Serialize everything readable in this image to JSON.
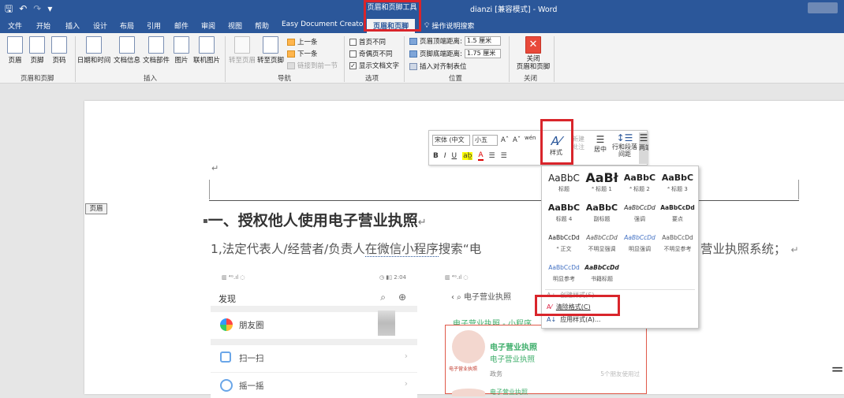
{
  "titlebar": {
    "quick_access": [
      "🖫",
      "↶",
      "↷",
      "▾"
    ],
    "contextual_tools": "页眉和页脚工具",
    "doc_title": "dianzi [兼容模式] - Word"
  },
  "tabs": [
    "文件",
    "开始",
    "插入",
    "设计",
    "布局",
    "引用",
    "邮件",
    "审阅",
    "视图",
    "帮助",
    "Easy Document Creato",
    "页眉和页脚",
    "操作说明搜索"
  ],
  "ribbon": {
    "header_footer": {
      "buttons": [
        "页眉",
        "页脚",
        "页码"
      ],
      "label": "页眉和页脚"
    },
    "insert": {
      "buttons": [
        "日期和时间",
        "文档信息",
        "文档部件",
        "图片",
        "联机图片"
      ],
      "label": "插入"
    },
    "navigation": {
      "buttons": [
        "转至页眉",
        "转至页脚"
      ],
      "prev": "上一条",
      "next": "下一条",
      "link": "链接到前一节",
      "label": "导航"
    },
    "options": {
      "first_page": "首页不同",
      "odd_even": "奇偶页不同",
      "show_text": "显示文档文字",
      "label": "选项"
    },
    "position": {
      "top_label": "页眉顶端距离:",
      "top_value": "1.5 厘米",
      "bottom_label": "页脚底端距离:",
      "bottom_value": "1.75 厘米",
      "align_tab": "插入对齐制表位",
      "label": "位置"
    },
    "close": {
      "button": "关闭\n页眉和页脚",
      "label": "关闭"
    }
  },
  "document": {
    "header_tag": "页眉",
    "pilcrow": "↵",
    "heading": "一、授权他人使用电子营业执照",
    "body_start": "1,法定代表人/经营者/负责人",
    "body_link": "在微信小程序",
    "body_mid": "搜索“电",
    "body_tail": "营业执照系统；",
    "phone1": {
      "status_left": "▥ ⁴ᴳ.ıl ◌",
      "status_right": "◷ ▮▯ 2:04",
      "title": "发现",
      "rows": [
        "朋友圈",
        "扫一扫",
        "摇一摇"
      ]
    },
    "phone2": {
      "status": "▥ ⁴ᴳ.ıl ◌",
      "nav": "‹  ⌕ 电子营业执照",
      "miniapp": "电子营业执照 - 小程序",
      "card_title": "电子营业执照",
      "card_sub": "电子营业执照",
      "card_gov": "政务",
      "card_users": "5个朋友使用过",
      "seal_caption": "电子营业执照",
      "next": "电子营业执照"
    },
    "right_edge": "="
  },
  "mini_toolbar": {
    "font": "宋体 (中文",
    "size": "小五",
    "grow": "Aˆ",
    "shrink": "Aˇ",
    "phonetic": "wén",
    "row2": [
      "B",
      "I",
      "U",
      "ab̲",
      "A",
      "☰",
      "☰"
    ],
    "styles": "样式",
    "new_comment": "新建\n批注",
    "center": "居中",
    "spacing": "行和段落\n间距",
    "align": "两端对齐"
  },
  "styles_gallery": {
    "cells": [
      {
        "sample": "AaBbC",
        "name": "标题"
      },
      {
        "sample": "AaBł",
        "name": "⁴ 标题 1"
      },
      {
        "sample": "AaBbC",
        "name": "⁴ 标题 2"
      },
      {
        "sample": "AaBbC",
        "name": "⁴ 标题 3"
      },
      {
        "sample": "AaBbC",
        "name": "标题 4"
      },
      {
        "sample": "AaBbC",
        "name": "副标题"
      },
      {
        "sample": "AaBbCcDd",
        "name": "强调"
      },
      {
        "sample": "AaBbCcDd",
        "name": "要点"
      },
      {
        "sample": "AaBbCcDd",
        "name": "⁴ 正文"
      },
      {
        "sample": "AaBbCcDd",
        "name": "不明显强调"
      },
      {
        "sample": "AaBbCcDd",
        "name": "明显强调"
      },
      {
        "sample": "AaBbCcDd",
        "name": "不明显参考"
      },
      {
        "sample": "AaBbCcDd",
        "name": "明显参考"
      },
      {
        "sample": "AaBbCcDd",
        "name": "书籍标题"
      }
    ],
    "create": "创建样式(S)",
    "clear": "清除格式(C)",
    "apply": "应用样式(A)..."
  },
  "colors": {
    "word_blue": "#2b579a",
    "highlight_red": "#d9252b",
    "wechat_green": "#3fae6b"
  }
}
